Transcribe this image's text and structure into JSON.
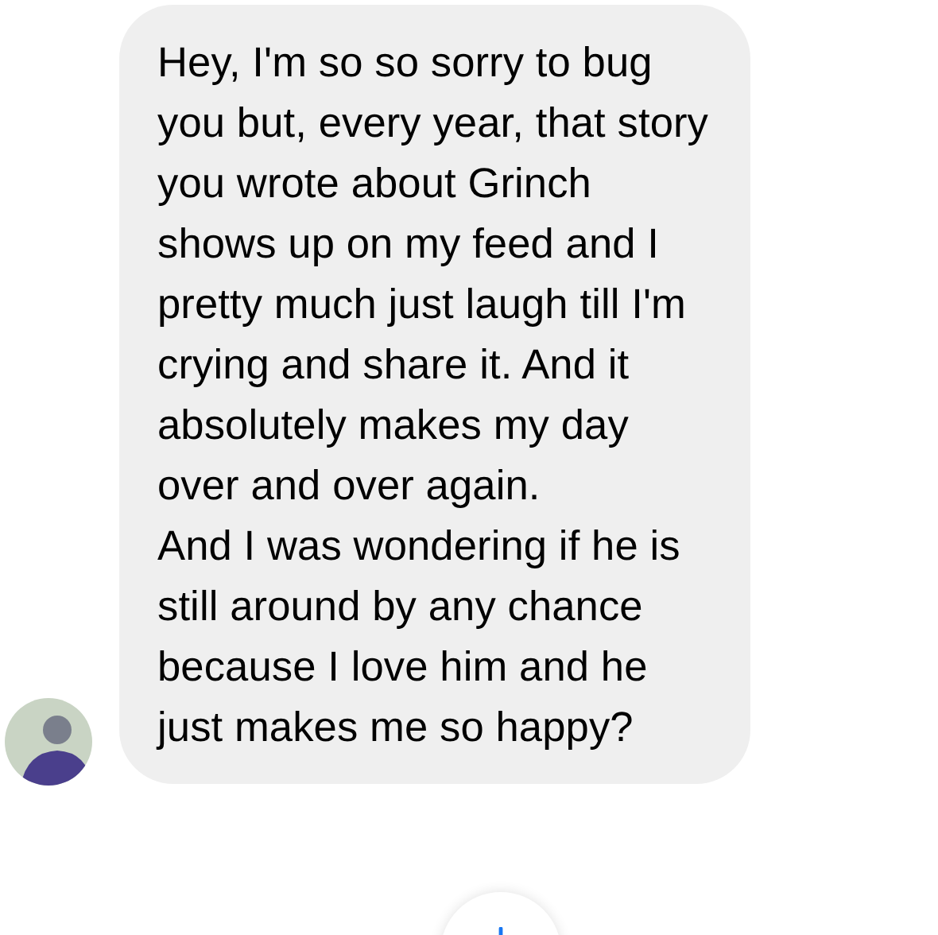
{
  "message": {
    "paragraphs": [
      "Hey, I'm so so sorry to bug you but, every year, that story you wrote about Grinch shows up on my feed and I pretty much just laugh till I'm crying and share it. And it absolutely makes my day over and over again.",
      "And I was wondering if he is still around by any chance because I love him and he just makes me so happy?"
    ]
  }
}
